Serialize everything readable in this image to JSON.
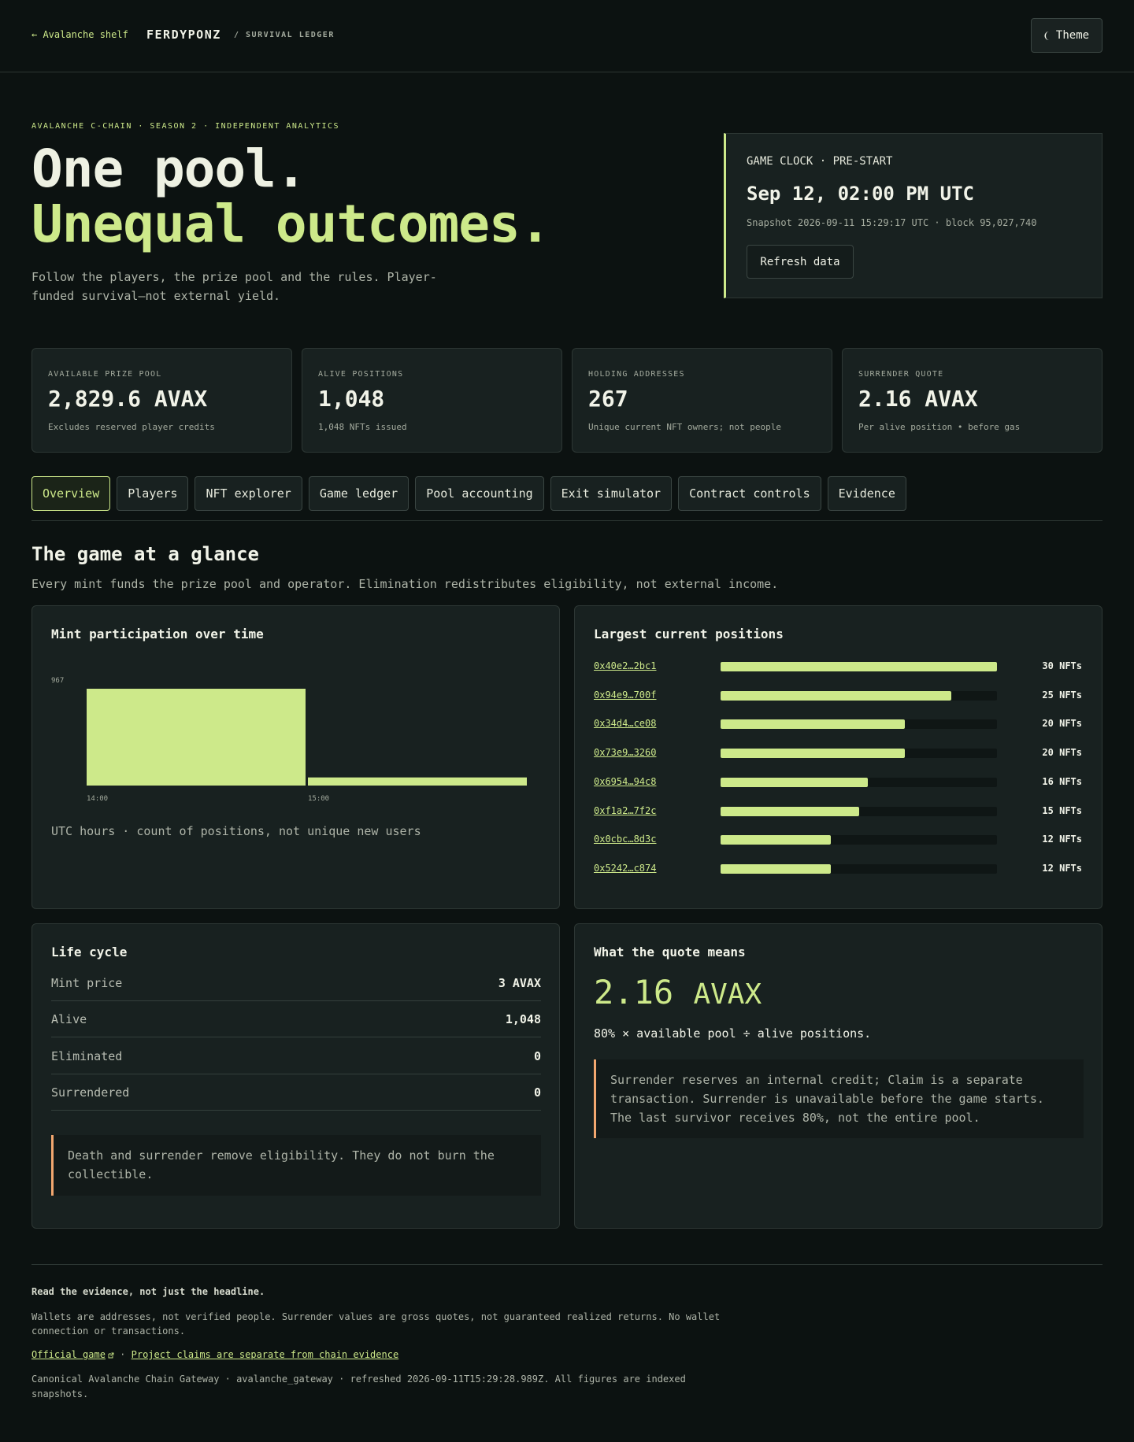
{
  "header": {
    "back_link": "← Avalanche shelf",
    "brand": "FERDYPONZ",
    "brand_sub": "/ SURVIVAL LEDGER",
    "theme_button": "Theme",
    "theme_icon": "moon-icon"
  },
  "hero": {
    "eyebrow": "AVALANCHE C-CHAIN · SEASON 2 · INDEPENDENT ANALYTICS",
    "title_line1": "One pool.",
    "title_line2": "Unequal outcomes.",
    "description": "Follow the players, the prize pool and the rules. Player-funded survival—not external yield."
  },
  "clock": {
    "label": "GAME CLOCK · PRE-START",
    "time": "Sep 12, 02:00 PM UTC",
    "snapshot": "Snapshot 2026-09-11 15:29:17 UTC · block 95,027,740",
    "refresh_button": "Refresh data"
  },
  "stats": [
    {
      "label": "AVAILABLE PRIZE POOL",
      "value": "2,829.6 AVAX",
      "note": "Excludes reserved player credits"
    },
    {
      "label": "ALIVE POSITIONS",
      "value": "1,048",
      "note": "1,048 NFTs issued"
    },
    {
      "label": "HOLDING ADDRESSES",
      "value": "267",
      "note": "Unique current NFT owners; not people"
    },
    {
      "label": "SURRENDER QUOTE",
      "value": "2.16 AVAX",
      "note": "Per alive position • before gas"
    }
  ],
  "tabs": [
    {
      "label": "Overview",
      "active": true
    },
    {
      "label": "Players"
    },
    {
      "label": "NFT explorer"
    },
    {
      "label": "Game ledger"
    },
    {
      "label": "Pool accounting"
    },
    {
      "label": "Exit simulator"
    },
    {
      "label": "Contract controls"
    },
    {
      "label": "Evidence"
    }
  ],
  "section": {
    "title": "The game at a glance",
    "description": "Every mint funds the prize pool and operator. Elimination redistributes eligibility, not external income."
  },
  "mint_panel": {
    "title": "Mint participation over time",
    "caption": "UTC hours · count of positions, not unique new users"
  },
  "chart_data": {
    "type": "bar",
    "title": "Mint participation over time",
    "categories": [
      "14:00",
      "15:00"
    ],
    "values": [
      967,
      81
    ],
    "y_tick_labels": [
      "967"
    ],
    "ylim": [
      0,
      967
    ],
    "grid": false,
    "color": "#cde98a"
  },
  "positions_panel": {
    "title": "Largest current positions",
    "max": 30,
    "rows": [
      {
        "address": "0x40e2…2bc1",
        "count": 30,
        "count_label": "30 NFTs"
      },
      {
        "address": "0x94e9…700f",
        "count": 25,
        "count_label": "25 NFTs"
      },
      {
        "address": "0x34d4…ce08",
        "count": 20,
        "count_label": "20 NFTs"
      },
      {
        "address": "0x73e9…3260",
        "count": 20,
        "count_label": "20 NFTs"
      },
      {
        "address": "0x6954…94c8",
        "count": 16,
        "count_label": "16 NFTs"
      },
      {
        "address": "0xf1a2…7f2c",
        "count": 15,
        "count_label": "15 NFTs"
      },
      {
        "address": "0x0cbc…8d3c",
        "count": 12,
        "count_label": "12 NFTs"
      },
      {
        "address": "0x5242…c874",
        "count": 12,
        "count_label": "12 NFTs"
      }
    ]
  },
  "lifecycle": {
    "title": "Life cycle",
    "rows": [
      {
        "label": "Mint price",
        "value": "3 AVAX"
      },
      {
        "label": "Alive",
        "value": "1,048"
      },
      {
        "label": "Eliminated",
        "value": "0"
      },
      {
        "label": "Surrendered",
        "value": "0"
      }
    ],
    "callout": "Death and surrender remove eligibility. They do not burn the collectible."
  },
  "quote_panel": {
    "title": "What the quote means",
    "amount": "2.16",
    "unit": "AVAX",
    "formula": "80% × available pool ÷ alive positions.",
    "callout": "Surrender reserves an internal credit; Claim is a separate transaction. Surrender is unavailable before the game starts. The last survivor receives 80%, not the entire pool."
  },
  "footer": {
    "heading": "Read the evidence, not just the headline.",
    "disclaimer": "Wallets are addresses, not verified people. Surrender values are gross quotes, not guaranteed realized returns. No wallet connection or transactions.",
    "link_official": "Official game",
    "link_separator": "·",
    "link_claims": "Project claims are separate from chain evidence",
    "source": "Canonical Avalanche Chain Gateway · avalanche_gateway · refreshed 2026-09-11T15:29:28.989Z. All figures are indexed snapshots."
  },
  "colors": {
    "accent": "#cde98a",
    "callout_border": "#f2a76f",
    "background": "#0c1211",
    "card": "#182120"
  }
}
